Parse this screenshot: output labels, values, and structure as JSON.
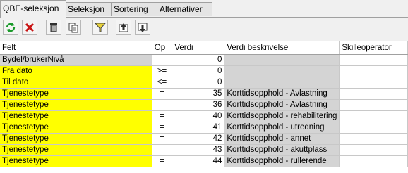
{
  "tabs": [
    {
      "label": "QBE-seleksjon",
      "active": true
    },
    {
      "label": "Seleksjon",
      "active": false
    },
    {
      "label": "Sortering",
      "active": false
    },
    {
      "label": "Alternativer",
      "active": false
    }
  ],
  "toolbar": {
    "icons": [
      "refresh-icon",
      "delete-icon",
      "trash-icon",
      "copy-icon",
      "filter-icon",
      "import-icon",
      "export-icon"
    ]
  },
  "grid": {
    "columns": [
      "Felt",
      "Op",
      "Verdi",
      "Verdi beskrivelse",
      "Skilleoperator"
    ],
    "rows": [
      {
        "felt": "Bydel/brukerNivå",
        "op": "=",
        "verdi": "0",
        "besk": "",
        "skille": "",
        "grey": true
      },
      {
        "felt": "Fra dato",
        "op": ">=",
        "verdi": "0",
        "besk": "",
        "skille": "",
        "grey": false
      },
      {
        "felt": "Til dato",
        "op": "<=",
        "verdi": "0",
        "besk": "",
        "skille": "",
        "grey": false
      },
      {
        "felt": "Tjenestetype",
        "op": "=",
        "verdi": "35",
        "besk": "Korttidsopphold - Avlastning",
        "skille": "",
        "grey": false
      },
      {
        "felt": "Tjenestetype",
        "op": "=",
        "verdi": "36",
        "besk": "Korttidsopphold - Avlastning",
        "skille": "",
        "grey": false
      },
      {
        "felt": "Tjenestetype",
        "op": "=",
        "verdi": "40",
        "besk": "Korttidsopphold -  rehabilitering",
        "skille": "",
        "grey": false
      },
      {
        "felt": "Tjenestetype",
        "op": "=",
        "verdi": "41",
        "besk": "Korttidsopphold - utredning",
        "skille": "",
        "grey": false
      },
      {
        "felt": "Tjenestetype",
        "op": "=",
        "verdi": "42",
        "besk": "Korttidsopphold - annet",
        "skille": "",
        "grey": false
      },
      {
        "felt": "Tjenestetype",
        "op": "=",
        "verdi": "43",
        "besk": "Korttidsopphold - akuttplass",
        "skille": "",
        "grey": false
      },
      {
        "felt": "Tjenestetype",
        "op": "=",
        "verdi": "44",
        "besk": "Korttidsopphold - rullerende",
        "skille": "",
        "grey": false
      }
    ]
  }
}
